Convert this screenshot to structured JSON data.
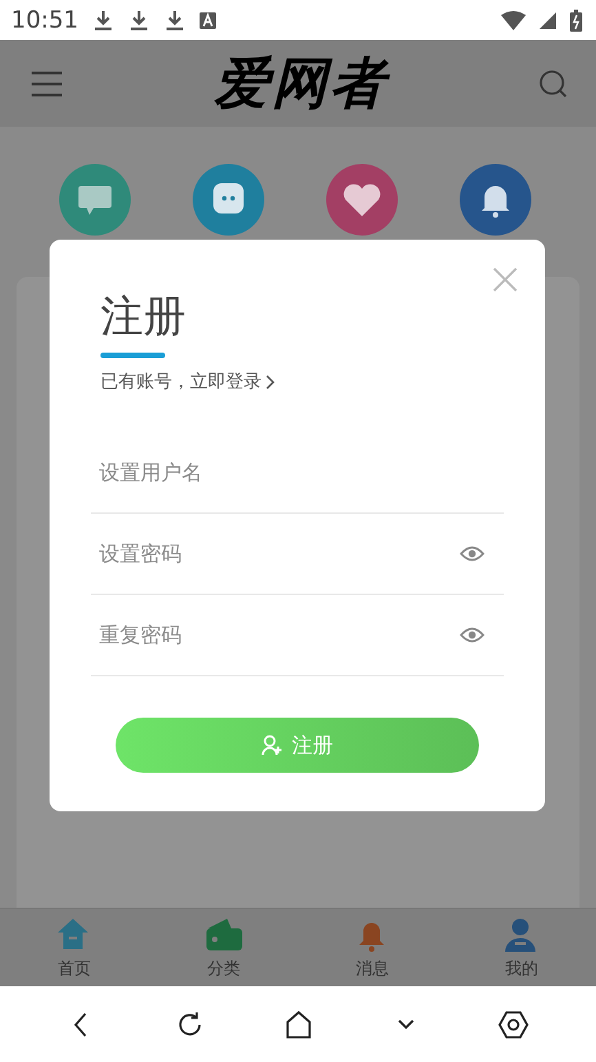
{
  "status_bar": {
    "time": "10:51"
  },
  "header": {
    "logo": "爱网者"
  },
  "shortcuts": [
    {
      "kind": "new"
    },
    {
      "kind": "chat"
    },
    {
      "kind": "heart"
    },
    {
      "kind": "bell"
    }
  ],
  "dialog": {
    "title": "注册",
    "login_link": "已有账号，立即登录",
    "fields": [
      {
        "kind": "text",
        "placeholder": "设置用户名"
      },
      {
        "kind": "password",
        "placeholder": "设置密码"
      },
      {
        "kind": "password",
        "placeholder": "重复密码"
      }
    ],
    "submit": "注册"
  },
  "tab_bar": [
    {
      "kind": "home",
      "label": "首页"
    },
    {
      "kind": "wallet",
      "label": "分类"
    },
    {
      "kind": "bell",
      "label": "消息"
    },
    {
      "kind": "user",
      "label": "我的"
    }
  ]
}
